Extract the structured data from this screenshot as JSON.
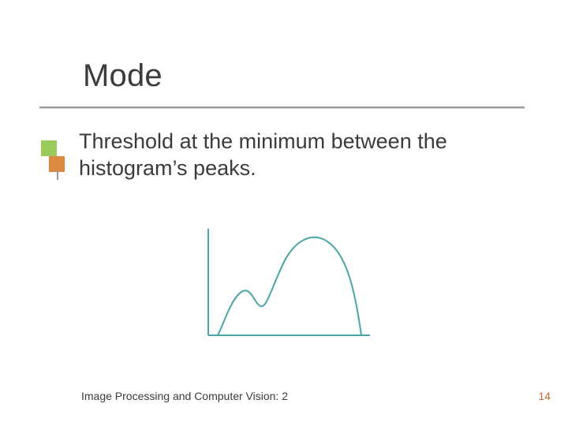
{
  "title": "Mode",
  "body_text": "Threshold at the minimum between the histogram’s peaks.",
  "footer_left": "Image Processing and Computer Vision: 2",
  "page_number": "14",
  "chart_data": {
    "type": "line",
    "title": "",
    "xlabel": "",
    "ylabel": "",
    "x": [
      0,
      12,
      22,
      32,
      42,
      55,
      70,
      86,
      100
    ],
    "values": [
      0,
      10,
      28,
      20,
      34,
      60,
      66,
      56,
      0
    ],
    "xlim": [
      0,
      100
    ],
    "ylim": [
      0,
      70
    ],
    "note": "Bimodal histogram sketch: small left peak, valley (minimum), larger right peak"
  }
}
